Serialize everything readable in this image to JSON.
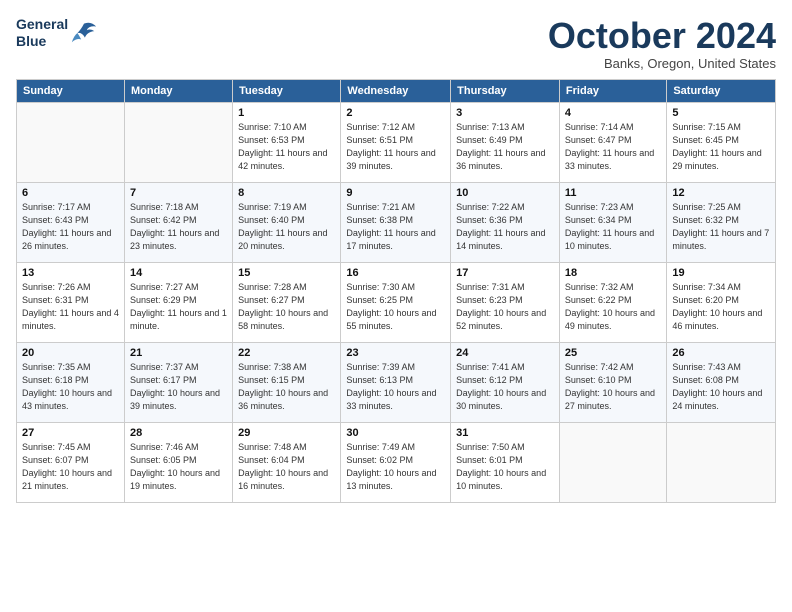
{
  "header": {
    "logo_line1": "General",
    "logo_line2": "Blue",
    "month": "October 2024",
    "location": "Banks, Oregon, United States"
  },
  "days_of_week": [
    "Sunday",
    "Monday",
    "Tuesday",
    "Wednesday",
    "Thursday",
    "Friday",
    "Saturday"
  ],
  "weeks": [
    [
      {
        "day": "",
        "sunrise": "",
        "sunset": "",
        "daylight": ""
      },
      {
        "day": "",
        "sunrise": "",
        "sunset": "",
        "daylight": ""
      },
      {
        "day": "1",
        "sunrise": "Sunrise: 7:10 AM",
        "sunset": "Sunset: 6:53 PM",
        "daylight": "Daylight: 11 hours and 42 minutes."
      },
      {
        "day": "2",
        "sunrise": "Sunrise: 7:12 AM",
        "sunset": "Sunset: 6:51 PM",
        "daylight": "Daylight: 11 hours and 39 minutes."
      },
      {
        "day": "3",
        "sunrise": "Sunrise: 7:13 AM",
        "sunset": "Sunset: 6:49 PM",
        "daylight": "Daylight: 11 hours and 36 minutes."
      },
      {
        "day": "4",
        "sunrise": "Sunrise: 7:14 AM",
        "sunset": "Sunset: 6:47 PM",
        "daylight": "Daylight: 11 hours and 33 minutes."
      },
      {
        "day": "5",
        "sunrise": "Sunrise: 7:15 AM",
        "sunset": "Sunset: 6:45 PM",
        "daylight": "Daylight: 11 hours and 29 minutes."
      }
    ],
    [
      {
        "day": "6",
        "sunrise": "Sunrise: 7:17 AM",
        "sunset": "Sunset: 6:43 PM",
        "daylight": "Daylight: 11 hours and 26 minutes."
      },
      {
        "day": "7",
        "sunrise": "Sunrise: 7:18 AM",
        "sunset": "Sunset: 6:42 PM",
        "daylight": "Daylight: 11 hours and 23 minutes."
      },
      {
        "day": "8",
        "sunrise": "Sunrise: 7:19 AM",
        "sunset": "Sunset: 6:40 PM",
        "daylight": "Daylight: 11 hours and 20 minutes."
      },
      {
        "day": "9",
        "sunrise": "Sunrise: 7:21 AM",
        "sunset": "Sunset: 6:38 PM",
        "daylight": "Daylight: 11 hours and 17 minutes."
      },
      {
        "day": "10",
        "sunrise": "Sunrise: 7:22 AM",
        "sunset": "Sunset: 6:36 PM",
        "daylight": "Daylight: 11 hours and 14 minutes."
      },
      {
        "day": "11",
        "sunrise": "Sunrise: 7:23 AM",
        "sunset": "Sunset: 6:34 PM",
        "daylight": "Daylight: 11 hours and 10 minutes."
      },
      {
        "day": "12",
        "sunrise": "Sunrise: 7:25 AM",
        "sunset": "Sunset: 6:32 PM",
        "daylight": "Daylight: 11 hours and 7 minutes."
      }
    ],
    [
      {
        "day": "13",
        "sunrise": "Sunrise: 7:26 AM",
        "sunset": "Sunset: 6:31 PM",
        "daylight": "Daylight: 11 hours and 4 minutes."
      },
      {
        "day": "14",
        "sunrise": "Sunrise: 7:27 AM",
        "sunset": "Sunset: 6:29 PM",
        "daylight": "Daylight: 11 hours and 1 minute."
      },
      {
        "day": "15",
        "sunrise": "Sunrise: 7:28 AM",
        "sunset": "Sunset: 6:27 PM",
        "daylight": "Daylight: 10 hours and 58 minutes."
      },
      {
        "day": "16",
        "sunrise": "Sunrise: 7:30 AM",
        "sunset": "Sunset: 6:25 PM",
        "daylight": "Daylight: 10 hours and 55 minutes."
      },
      {
        "day": "17",
        "sunrise": "Sunrise: 7:31 AM",
        "sunset": "Sunset: 6:23 PM",
        "daylight": "Daylight: 10 hours and 52 minutes."
      },
      {
        "day": "18",
        "sunrise": "Sunrise: 7:32 AM",
        "sunset": "Sunset: 6:22 PM",
        "daylight": "Daylight: 10 hours and 49 minutes."
      },
      {
        "day": "19",
        "sunrise": "Sunrise: 7:34 AM",
        "sunset": "Sunset: 6:20 PM",
        "daylight": "Daylight: 10 hours and 46 minutes."
      }
    ],
    [
      {
        "day": "20",
        "sunrise": "Sunrise: 7:35 AM",
        "sunset": "Sunset: 6:18 PM",
        "daylight": "Daylight: 10 hours and 43 minutes."
      },
      {
        "day": "21",
        "sunrise": "Sunrise: 7:37 AM",
        "sunset": "Sunset: 6:17 PM",
        "daylight": "Daylight: 10 hours and 39 minutes."
      },
      {
        "day": "22",
        "sunrise": "Sunrise: 7:38 AM",
        "sunset": "Sunset: 6:15 PM",
        "daylight": "Daylight: 10 hours and 36 minutes."
      },
      {
        "day": "23",
        "sunrise": "Sunrise: 7:39 AM",
        "sunset": "Sunset: 6:13 PM",
        "daylight": "Daylight: 10 hours and 33 minutes."
      },
      {
        "day": "24",
        "sunrise": "Sunrise: 7:41 AM",
        "sunset": "Sunset: 6:12 PM",
        "daylight": "Daylight: 10 hours and 30 minutes."
      },
      {
        "day": "25",
        "sunrise": "Sunrise: 7:42 AM",
        "sunset": "Sunset: 6:10 PM",
        "daylight": "Daylight: 10 hours and 27 minutes."
      },
      {
        "day": "26",
        "sunrise": "Sunrise: 7:43 AM",
        "sunset": "Sunset: 6:08 PM",
        "daylight": "Daylight: 10 hours and 24 minutes."
      }
    ],
    [
      {
        "day": "27",
        "sunrise": "Sunrise: 7:45 AM",
        "sunset": "Sunset: 6:07 PM",
        "daylight": "Daylight: 10 hours and 21 minutes."
      },
      {
        "day": "28",
        "sunrise": "Sunrise: 7:46 AM",
        "sunset": "Sunset: 6:05 PM",
        "daylight": "Daylight: 10 hours and 19 minutes."
      },
      {
        "day": "29",
        "sunrise": "Sunrise: 7:48 AM",
        "sunset": "Sunset: 6:04 PM",
        "daylight": "Daylight: 10 hours and 16 minutes."
      },
      {
        "day": "30",
        "sunrise": "Sunrise: 7:49 AM",
        "sunset": "Sunset: 6:02 PM",
        "daylight": "Daylight: 10 hours and 13 minutes."
      },
      {
        "day": "31",
        "sunrise": "Sunrise: 7:50 AM",
        "sunset": "Sunset: 6:01 PM",
        "daylight": "Daylight: 10 hours and 10 minutes."
      },
      {
        "day": "",
        "sunrise": "",
        "sunset": "",
        "daylight": ""
      },
      {
        "day": "",
        "sunrise": "",
        "sunset": "",
        "daylight": ""
      }
    ]
  ]
}
